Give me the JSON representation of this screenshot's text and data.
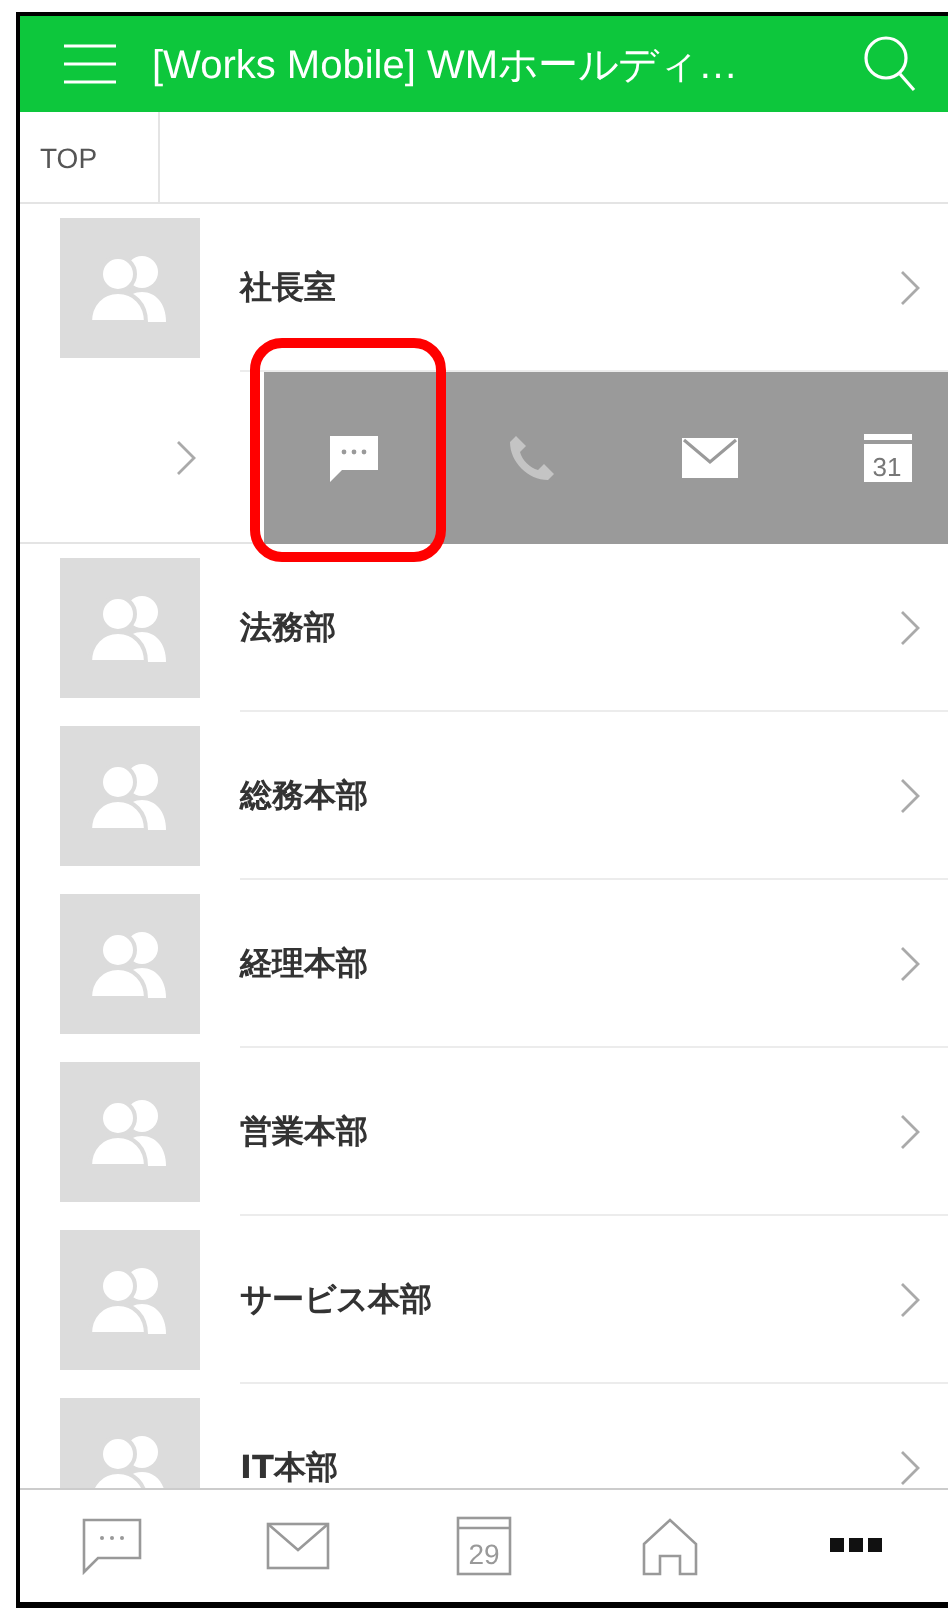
{
  "header": {
    "title": "[Works Mobile] WMホールディ…"
  },
  "breadcrumb": {
    "label": "TOP"
  },
  "rows": [
    {
      "kind": "department",
      "name": "社長室"
    },
    {
      "kind": "swiped",
      "actions": [
        {
          "kind": "chat",
          "highlighted": true
        },
        {
          "kind": "phone",
          "highlighted": false
        },
        {
          "kind": "mail",
          "highlighted": false
        },
        {
          "kind": "calendar",
          "date": "31",
          "highlighted": false
        }
      ]
    },
    {
      "kind": "department",
      "name": "法務部"
    },
    {
      "kind": "department",
      "name": "総務本部"
    },
    {
      "kind": "department",
      "name": "経理本部"
    },
    {
      "kind": "department",
      "name": "営業本部"
    },
    {
      "kind": "department",
      "name": "サービス本部"
    },
    {
      "kind": "department",
      "name": "IT本部"
    }
  ],
  "tab_bar": [
    {
      "kind": "chat",
      "selected": false
    },
    {
      "kind": "mail",
      "selected": false
    },
    {
      "kind": "calendar",
      "date": "29",
      "selected": false
    },
    {
      "kind": "home",
      "selected": false
    },
    {
      "kind": "more",
      "selected": true
    }
  ]
}
